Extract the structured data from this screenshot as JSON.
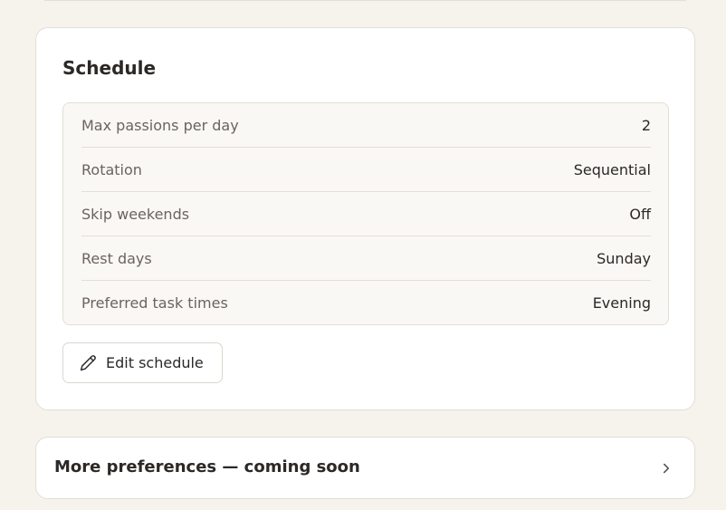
{
  "schedule": {
    "title": "Schedule",
    "settings": [
      {
        "label": "Max passions per day",
        "value": "2"
      },
      {
        "label": "Rotation",
        "value": "Sequential"
      },
      {
        "label": "Skip weekends",
        "value": "Off"
      },
      {
        "label": "Rest days",
        "value": "Sunday"
      },
      {
        "label": "Preferred task times",
        "value": "Evening"
      }
    ],
    "edit_button": {
      "label": "Edit schedule",
      "icon": "pencil-icon"
    }
  },
  "more_preferences": {
    "label": "More preferences — coming soon",
    "icon": "chevron-right-icon"
  },
  "colors": {
    "background": "#f6f3ed",
    "card": "#ffffff",
    "border": "#e3ded6",
    "text": "#2b2826",
    "muted_text": "#6a645e"
  }
}
